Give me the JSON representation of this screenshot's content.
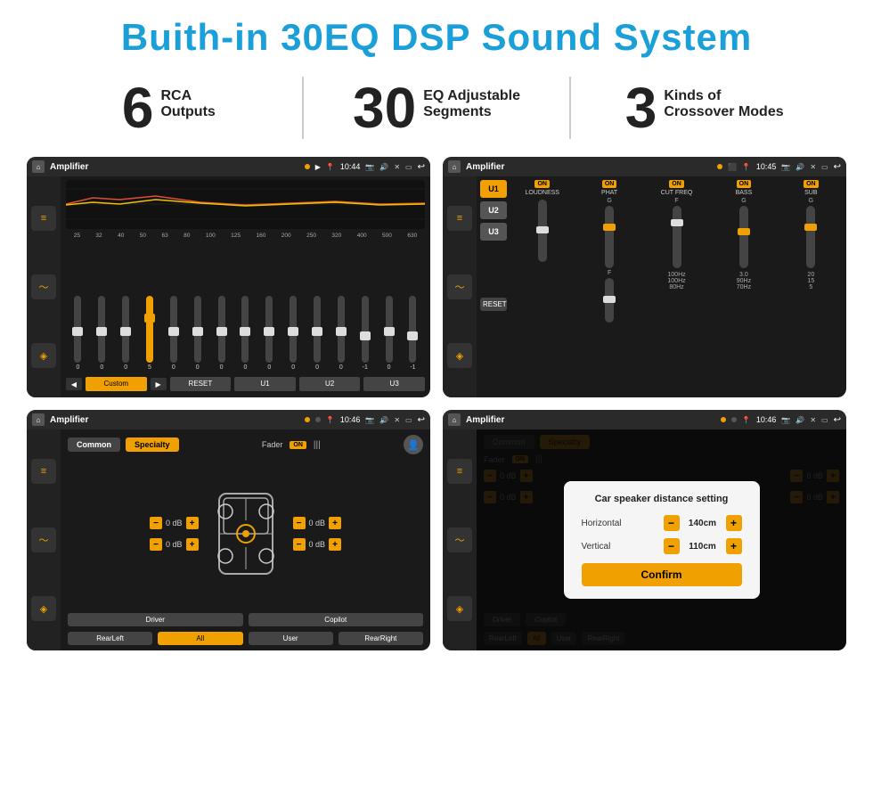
{
  "header": {
    "title": "Buith-in 30EQ DSP Sound System"
  },
  "stats": [
    {
      "number": "6",
      "line1": "RCA",
      "line2": "Outputs"
    },
    {
      "number": "30",
      "line1": "EQ Adjustable",
      "line2": "Segments"
    },
    {
      "number": "3",
      "line1": "Kinds of",
      "line2": "Crossover Modes"
    }
  ],
  "screen1": {
    "status_title": "Amplifier",
    "time": "10:44",
    "freq_labels": [
      "25",
      "32",
      "40",
      "50",
      "63",
      "80",
      "100",
      "125",
      "160",
      "200",
      "250",
      "320",
      "400",
      "500",
      "630"
    ],
    "slider_values": [
      "0",
      "0",
      "0",
      "5",
      "0",
      "0",
      "0",
      "0",
      "0",
      "0",
      "0",
      "0",
      "-1",
      "0",
      "-1"
    ],
    "modes": [
      "Custom",
      "RESET",
      "U1",
      "U2",
      "U3"
    ]
  },
  "screen2": {
    "status_title": "Amplifier",
    "time": "10:45",
    "channels": [
      "U1",
      "U2",
      "U3"
    ],
    "controls": [
      {
        "label": "LOUDNESS",
        "on": true
      },
      {
        "label": "PHAT",
        "on": true
      },
      {
        "label": "CUT FREQ",
        "on": true
      },
      {
        "label": "BASS",
        "on": true
      },
      {
        "label": "SUB",
        "on": true
      }
    ]
  },
  "screen3": {
    "status_title": "Amplifier",
    "time": "10:46",
    "tabs": [
      "Common",
      "Specialty"
    ],
    "active_tab": "Specialty",
    "fader_label": "Fader",
    "fader_on": true,
    "db_values": [
      "0 dB",
      "0 dB",
      "0 dB",
      "0 dB"
    ],
    "bottom_buttons": [
      "Driver",
      "All",
      "Copilot",
      "RearLeft",
      "User",
      "RearRight"
    ]
  },
  "screen4": {
    "status_title": "Amplifier",
    "time": "10:46",
    "tabs": [
      "Common",
      "Specialty"
    ],
    "dialog": {
      "title": "Car speaker distance setting",
      "horizontal_label": "Horizontal",
      "horizontal_value": "140cm",
      "vertical_label": "Vertical",
      "vertical_value": "110cm",
      "confirm_label": "Confirm"
    },
    "right_db_values": [
      "0 dB",
      "0 dB"
    ],
    "bottom_buttons": [
      "Driver",
      "Copilot",
      "RearLeft",
      "All",
      "User",
      "RearRight"
    ]
  }
}
